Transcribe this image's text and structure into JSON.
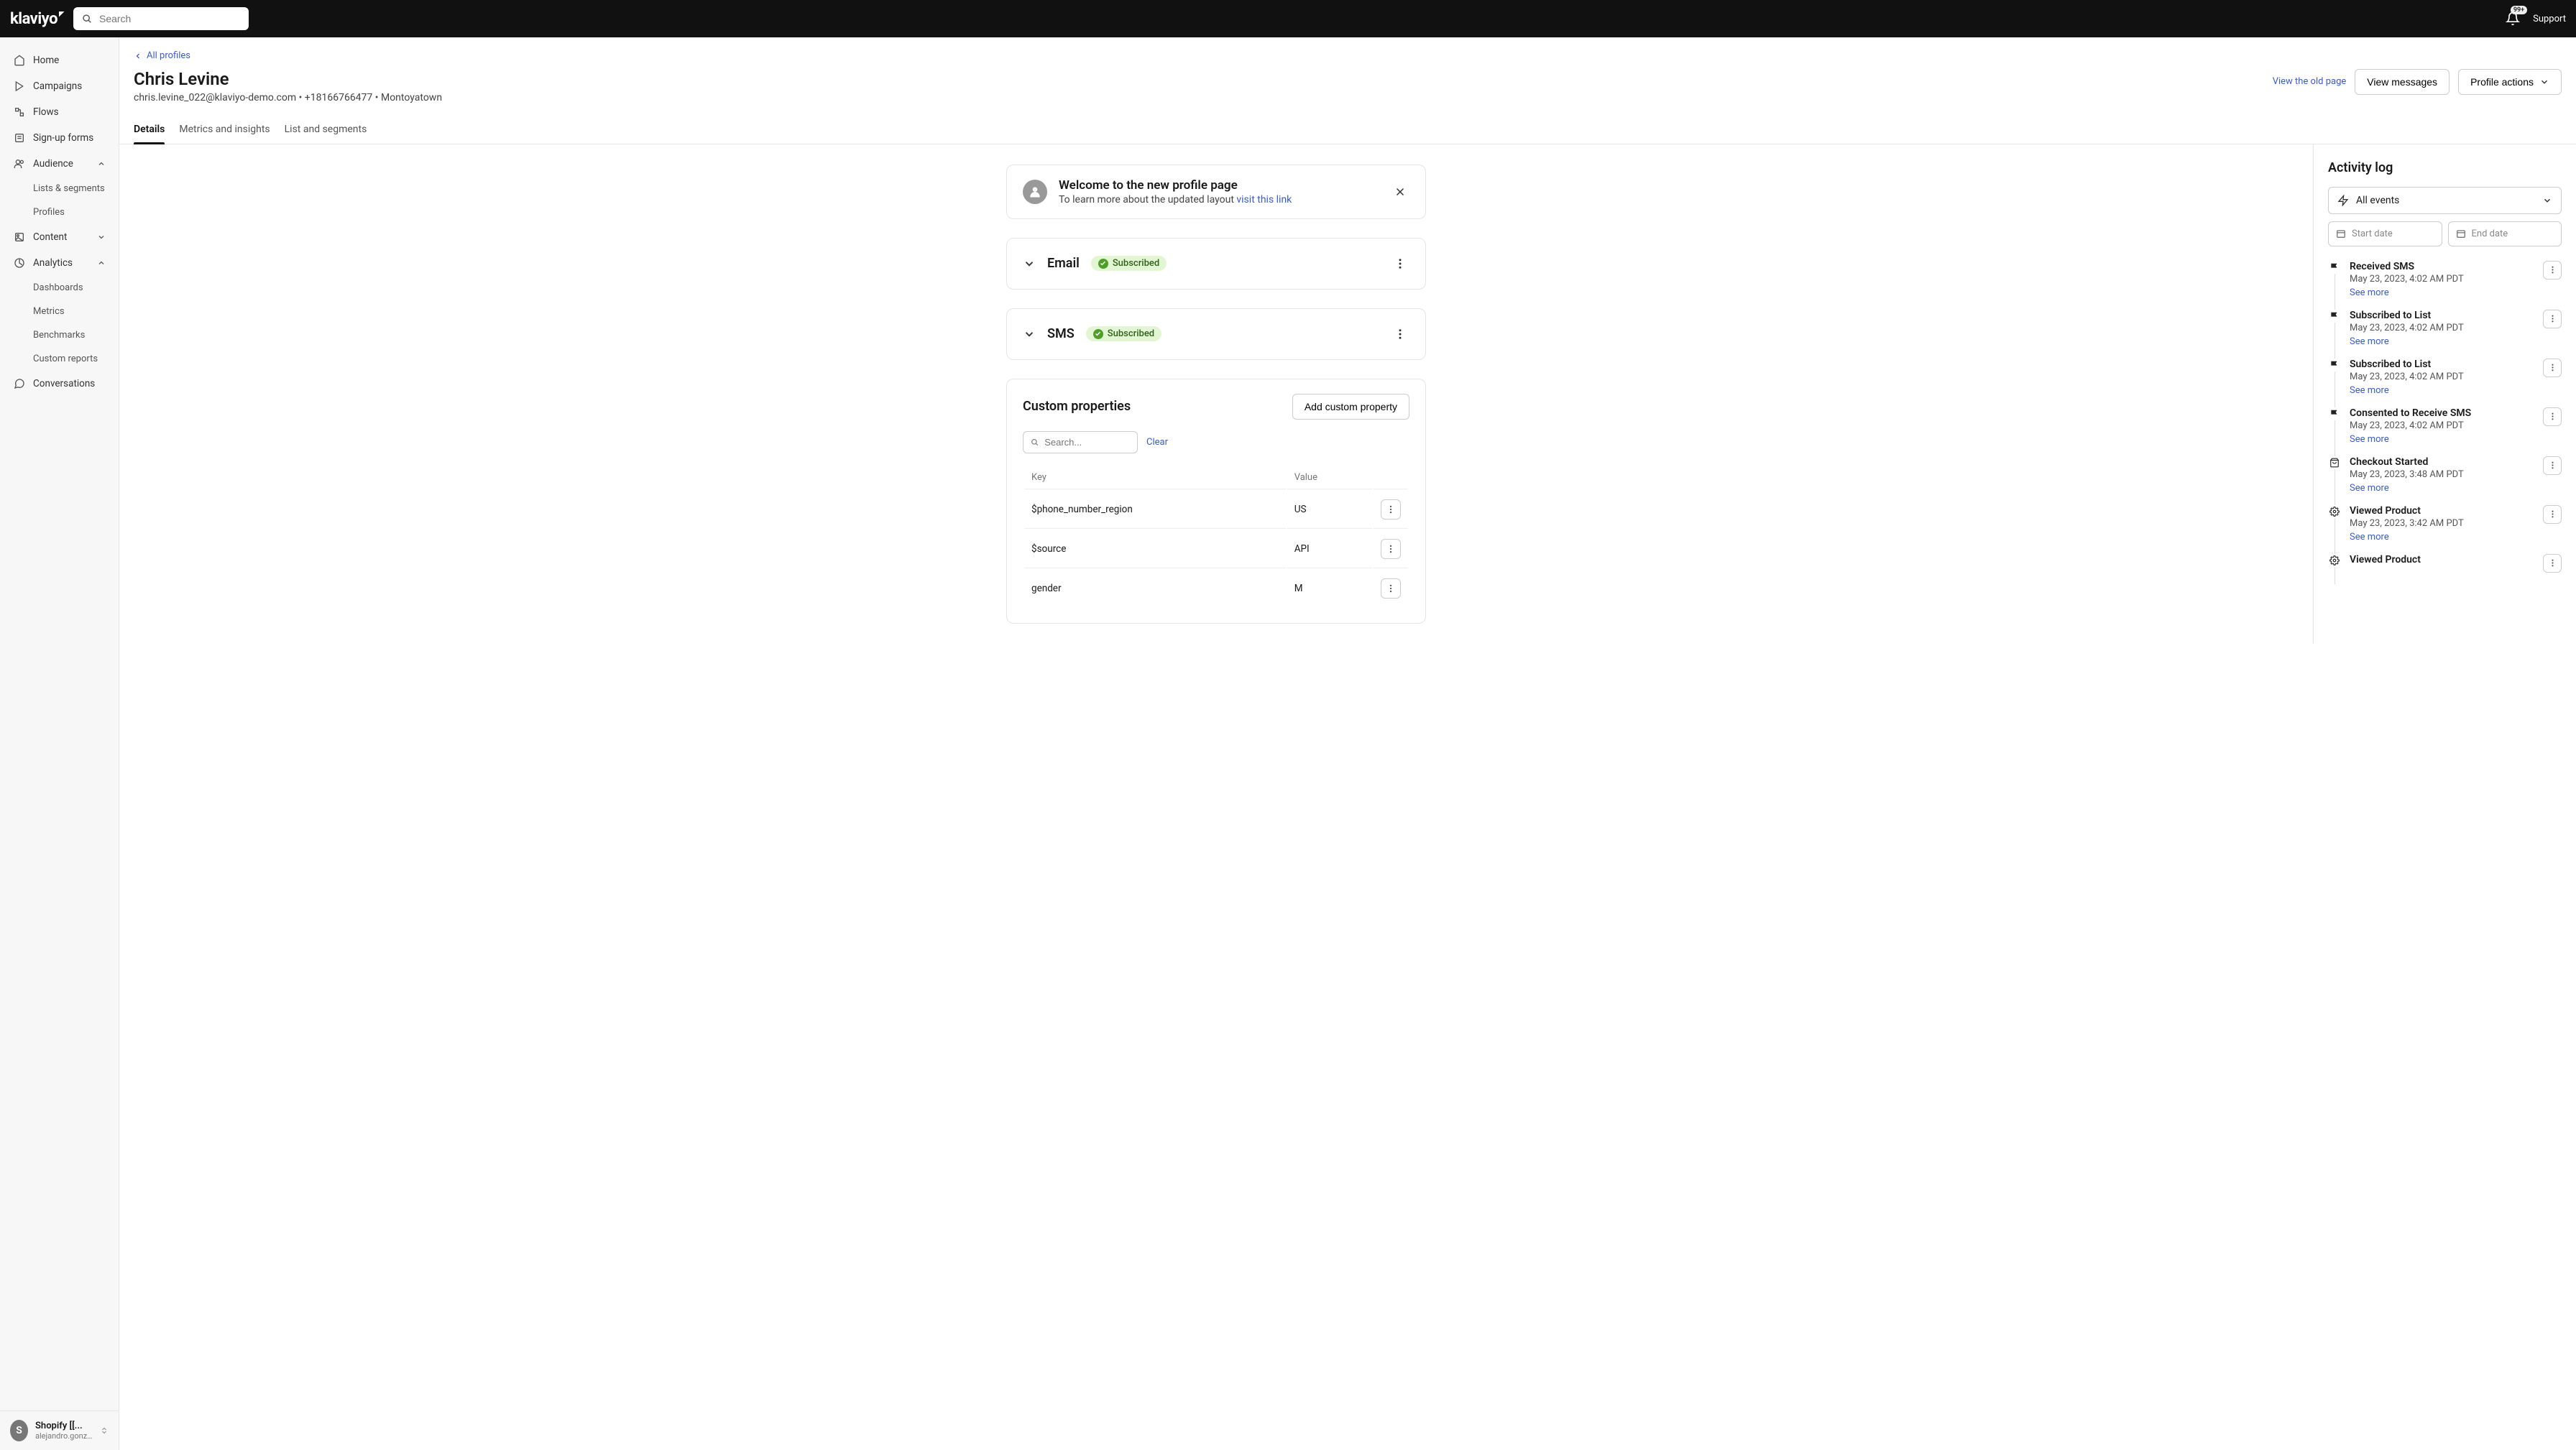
{
  "topbar": {
    "logo": "klaviyo",
    "search_placeholder": "Search",
    "notif_badge": "99+",
    "support": "Support"
  },
  "sidebar": {
    "items": [
      {
        "label": "Home",
        "icon": "home"
      },
      {
        "label": "Campaigns",
        "icon": "campaigns"
      },
      {
        "label": "Flows",
        "icon": "flows"
      },
      {
        "label": "Sign-up forms",
        "icon": "forms"
      },
      {
        "label": "Audience",
        "icon": "audience",
        "expanded": true,
        "children": [
          "Lists & segments",
          "Profiles"
        ]
      },
      {
        "label": "Content",
        "icon": "content",
        "expandable": true
      },
      {
        "label": "Analytics",
        "icon": "analytics",
        "expanded": true,
        "children": [
          "Dashboards",
          "Metrics",
          "Benchmarks",
          "Custom reports"
        ]
      },
      {
        "label": "Conversations",
        "icon": "conversations"
      }
    ],
    "account": {
      "avatar_letter": "S",
      "name": "Shopify [[...",
      "user": "alejandro.gonz..."
    }
  },
  "breadcrumb": {
    "label": "All profiles"
  },
  "profile": {
    "name": "Chris Levine",
    "email": "chris.levine_022@klaviyo-demo.com",
    "phone": "+18166766477",
    "location": "Montoyatown"
  },
  "actions": {
    "old_page": "View the old page",
    "view_messages": "View messages",
    "profile_actions": "Profile actions"
  },
  "tabs": [
    "Details",
    "Metrics and insights",
    "List and segments"
  ],
  "welcome": {
    "title": "Welcome to the new profile page",
    "subtitle": "To learn more about the updated layout ",
    "link": "visit this link"
  },
  "channels": [
    {
      "name": "Email",
      "status": "Subscribed"
    },
    {
      "name": "SMS",
      "status": "Subscribed"
    }
  ],
  "custom_props": {
    "title": "Custom properties",
    "add_btn": "Add custom property",
    "search_placeholder": "Search...",
    "clear": "Clear",
    "headers": [
      "Key",
      "Value"
    ],
    "rows": [
      {
        "key": "$phone_number_region",
        "value": "US"
      },
      {
        "key": "$source",
        "value": "API"
      },
      {
        "key": "gender",
        "value": "M"
      }
    ]
  },
  "activity": {
    "title": "Activity log",
    "filter": "All events",
    "start_placeholder": "Start date",
    "end_placeholder": "End date",
    "see_more": "See more",
    "events": [
      {
        "name": "Received SMS",
        "date": "May 23, 2023, 4:02 AM PDT",
        "icon": "flag"
      },
      {
        "name": "Subscribed to List",
        "date": "May 23, 2023, 4:02 AM PDT",
        "icon": "flag"
      },
      {
        "name": "Subscribed to List",
        "date": "May 23, 2023, 4:02 AM PDT",
        "icon": "flag"
      },
      {
        "name": "Consented to Receive SMS",
        "date": "May 23, 2023, 4:02 AM PDT",
        "icon": "flag"
      },
      {
        "name": "Checkout Started",
        "date": "May 23, 2023, 3:48 AM PDT",
        "icon": "bag"
      },
      {
        "name": "Viewed Product",
        "date": "May 23, 2023, 3:42 AM PDT",
        "icon": "gear"
      },
      {
        "name": "Viewed Product",
        "date": "",
        "icon": "gear"
      }
    ]
  }
}
